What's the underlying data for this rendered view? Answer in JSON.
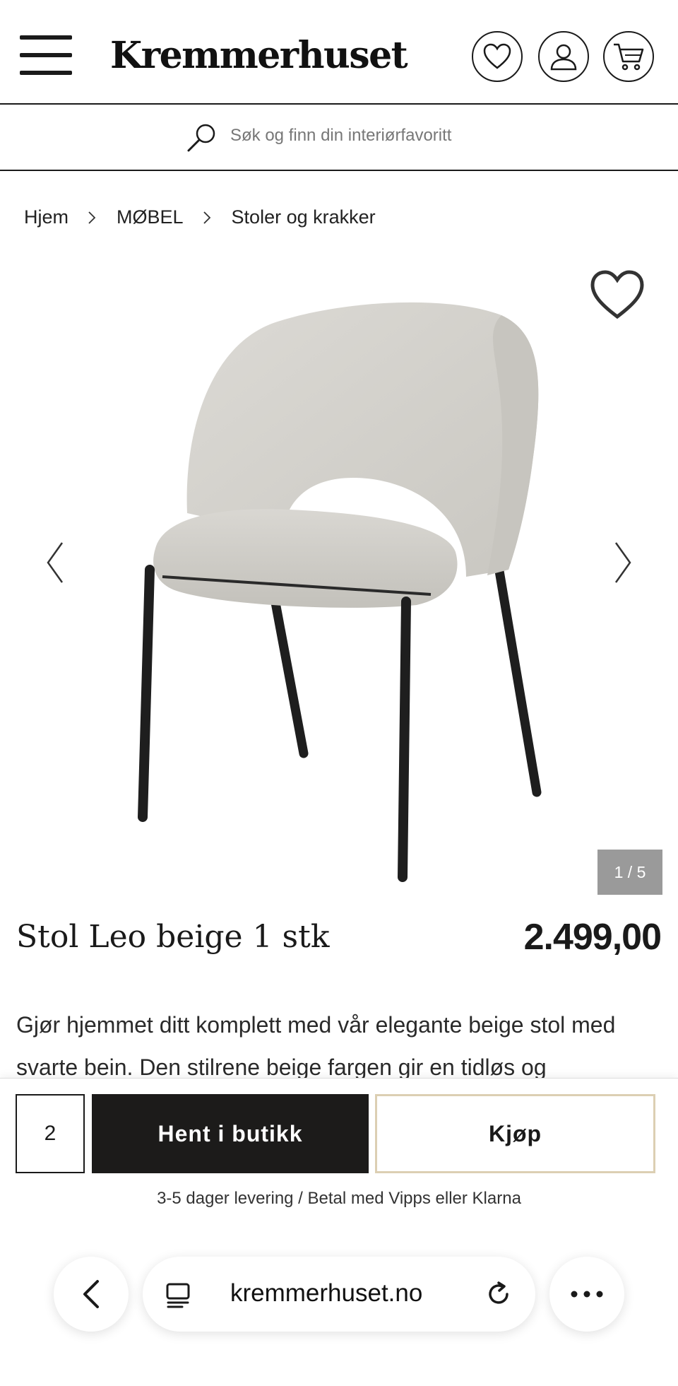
{
  "header": {
    "logo": "Kremmerhuset",
    "icons": [
      "menu-icon",
      "heart-icon",
      "user-icon",
      "cart-icon"
    ]
  },
  "search": {
    "placeholder": "Søk og finn din interiørfavoritt"
  },
  "breadcrumb": [
    "Hjem",
    "MØBEL",
    "Stoler og krakker"
  ],
  "gallery": {
    "counter": "1 / 5",
    "current_image": 1,
    "total_images": 5
  },
  "product": {
    "title": "Stol Leo beige 1 stk",
    "price": "2.499,00",
    "description": "Gjør hjemmet ditt komplett med vår elegante beige stol med svarte bein. Den stilrene beige fargen gir en tidløs og"
  },
  "buybar": {
    "quantity": "2",
    "pickup_label": "Hent i butikk",
    "buy_label": "Kjøp",
    "delivery_info": "3-5 dager levering / Betal med Vipps eller Klarna"
  },
  "browser": {
    "url": "kremmerhuset.no"
  },
  "colors": {
    "text": "#1a1a1a",
    "pickup_bg": "#1c1b1a",
    "buy_border": "#dccfb3",
    "counter_bg": "#9a9a9a",
    "chair_fabric": "#d6d4cf",
    "chair_legs": "#1e1e1e"
  }
}
